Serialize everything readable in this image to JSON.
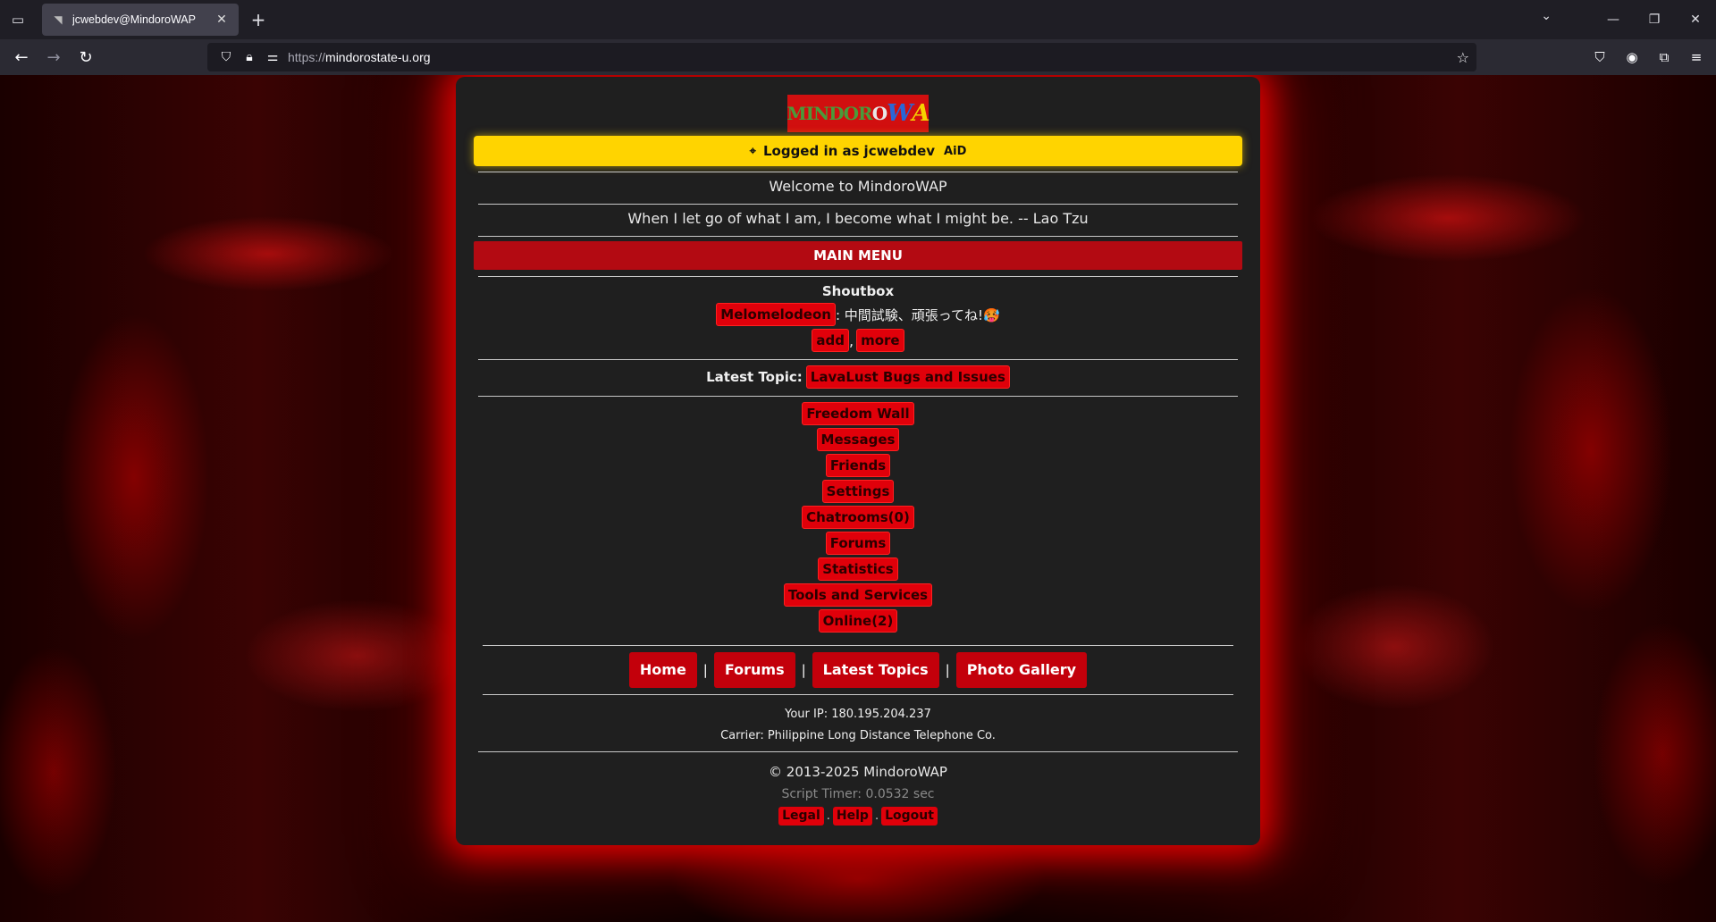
{
  "browser": {
    "tab_title": "jcwebdev@MindoroWAP",
    "url_scheme": "https://",
    "url_host": "mindorostate-u.org"
  },
  "site": {
    "logo_parts": [
      "MINDOR",
      "O",
      "W",
      "A"
    ],
    "login": {
      "prefix": "Logged in as",
      "username": "jcwebdev",
      "badge": "AiD"
    },
    "welcome": "Welcome to MindoroWAP",
    "quote": "When I let go of what I am, I become what I might be. -- Lao Tzu",
    "main_menu": "MAIN MENU",
    "shoutbox": {
      "title": "Shoutbox",
      "author": "Melomelodeon",
      "message": ": 中間試験、頑張ってね!🥵",
      "add": "add",
      "more": "more",
      "sep": ","
    },
    "latest_topic": {
      "label": "Latest Topic:",
      "topic": "LavaLust Bugs and Issues"
    },
    "menu_items": [
      "Freedom Wall",
      "Messages",
      "Friends",
      "Settings",
      "Chatrooms(0)",
      "Forums",
      "Statistics",
      "Tools and Services",
      "Online(2)"
    ],
    "nav": [
      "Home",
      "Forums",
      "Latest Topics",
      "Photo Gallery"
    ],
    "nav_sep": "|",
    "ip": "Your IP: 180.195.204.237",
    "carrier": "Carrier: Philippine Long Distance Telephone Co.",
    "copyright": "© 2013-2025 MindoroWAP",
    "timer": "Script Timer: 0.0532 sec",
    "footer_links": [
      "Legal",
      "Help",
      "Logout"
    ],
    "footer_sep": "."
  }
}
